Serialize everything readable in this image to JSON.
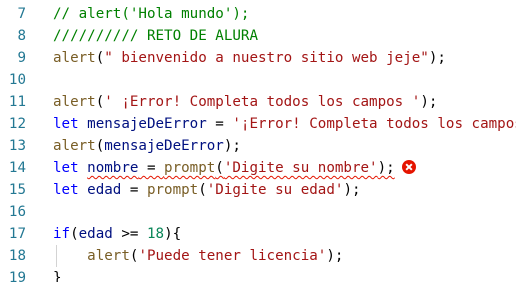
{
  "editor": {
    "lines": [
      {
        "number": "7",
        "tokens": [
          {
            "type": "cmt",
            "text": "// alert('Hola mundo');"
          }
        ]
      },
      {
        "number": "8",
        "tokens": [
          {
            "type": "cmt",
            "text": "////////// RETO DE ALURA"
          }
        ]
      },
      {
        "number": "9",
        "tokens": [
          {
            "type": "fn",
            "text": "alert"
          },
          {
            "type": "plain",
            "text": "("
          },
          {
            "type": "str",
            "text": "\" bienvenido a nuestro sitio web jeje\""
          },
          {
            "type": "plain",
            "text": ");"
          }
        ]
      },
      {
        "number": "10",
        "tokens": []
      },
      {
        "number": "11",
        "tokens": [
          {
            "type": "fn",
            "text": "alert"
          },
          {
            "type": "plain",
            "text": "("
          },
          {
            "type": "str",
            "text": "' ¡Error! Completa todos los campos '"
          },
          {
            "type": "plain",
            "text": ");"
          }
        ]
      },
      {
        "number": "12",
        "tokens": [
          {
            "type": "kw",
            "text": "let"
          },
          {
            "type": "plain",
            "text": " "
          },
          {
            "type": "var",
            "text": "mensajeDeError"
          },
          {
            "type": "plain",
            "text": " = "
          },
          {
            "type": "str",
            "text": "'¡Error! Completa todos los campos'"
          }
        ]
      },
      {
        "number": "13",
        "tokens": [
          {
            "type": "fn",
            "text": "alert"
          },
          {
            "type": "plain",
            "text": "("
          },
          {
            "type": "var",
            "text": "mensajeDeError"
          },
          {
            "type": "plain",
            "text": ");"
          }
        ]
      },
      {
        "number": "14",
        "tokens": [
          {
            "type": "kw",
            "text": "let"
          },
          {
            "type": "plain",
            "text": " "
          },
          {
            "type": "var",
            "text": "nombre",
            "squiggle": true
          },
          {
            "type": "plain",
            "text": " = ",
            "squiggle": true
          },
          {
            "type": "fn",
            "text": "prompt",
            "squiggle": true
          },
          {
            "type": "plain",
            "text": "(",
            "squiggle": true
          },
          {
            "type": "str",
            "text": "'Digite su nombre'",
            "squiggle": true
          },
          {
            "type": "plain",
            "text": ");",
            "squiggle": true
          }
        ],
        "error_icon": "error-circle-icon"
      },
      {
        "number": "15",
        "tokens": [
          {
            "type": "kw",
            "text": "let"
          },
          {
            "type": "plain",
            "text": " "
          },
          {
            "type": "var",
            "text": "edad"
          },
          {
            "type": "plain",
            "text": " = "
          },
          {
            "type": "fn",
            "text": "prompt"
          },
          {
            "type": "plain",
            "text": "("
          },
          {
            "type": "str",
            "text": "'Digite su edad'"
          },
          {
            "type": "plain",
            "text": ");"
          }
        ]
      },
      {
        "number": "16",
        "tokens": []
      },
      {
        "number": "17",
        "tokens": [
          {
            "type": "kw",
            "text": "if"
          },
          {
            "type": "plain",
            "text": "("
          },
          {
            "type": "var",
            "text": "edad"
          },
          {
            "type": "plain",
            "text": " >= "
          },
          {
            "type": "num",
            "text": "18"
          },
          {
            "type": "plain",
            "text": "){"
          }
        ]
      },
      {
        "number": "18",
        "tokens": [
          {
            "type": "plain",
            "text": "    "
          },
          {
            "type": "fn",
            "text": "alert"
          },
          {
            "type": "plain",
            "text": "("
          },
          {
            "type": "str",
            "text": "'Puede tener licencia'"
          },
          {
            "type": "plain",
            "text": ");"
          }
        ],
        "indent_guide": true
      },
      {
        "number": "19",
        "tokens": [
          {
            "type": "plain",
            "text": "}"
          }
        ]
      }
    ],
    "colors": {
      "line_number": "#237893",
      "keyword": "#0000ff",
      "variable": "#001080",
      "function": "#795e26",
      "string": "#a31515",
      "number": "#098658",
      "comment": "#008000",
      "error": "#e51400"
    }
  }
}
